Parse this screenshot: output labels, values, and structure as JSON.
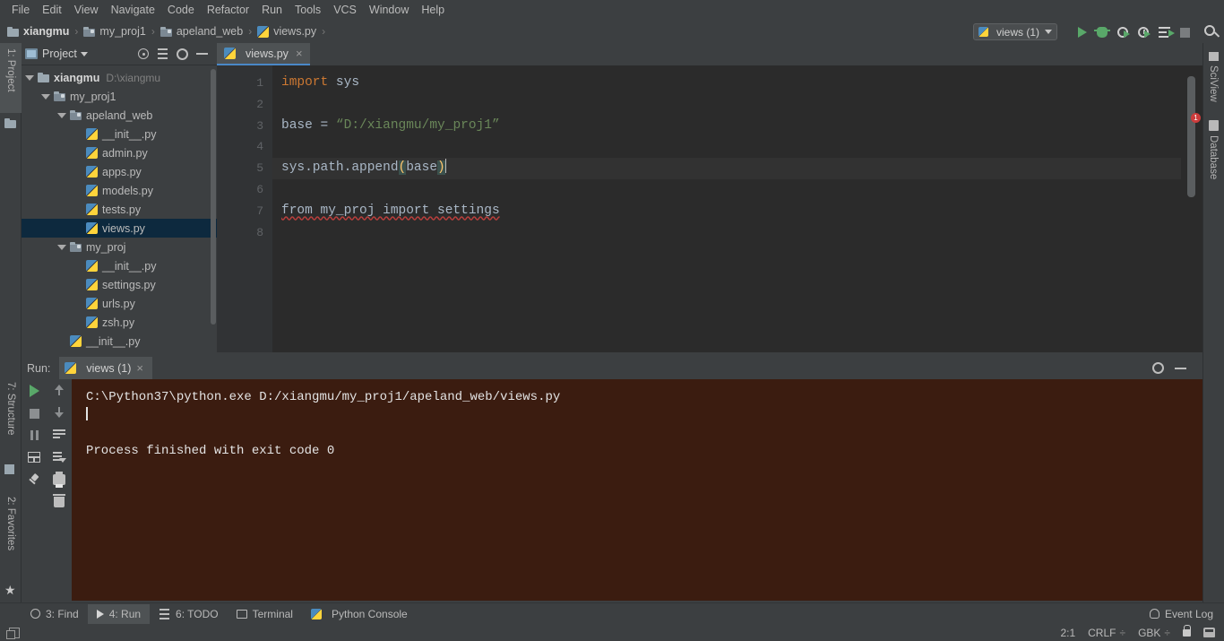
{
  "menu": {
    "items": [
      "File",
      "Edit",
      "View",
      "Navigate",
      "Code",
      "Refactor",
      "Run",
      "Tools",
      "VCS",
      "Window",
      "Help"
    ]
  },
  "breadcrumb": {
    "separator": "›",
    "items": [
      {
        "label": "xiangmu",
        "icon": "folder-icon"
      },
      {
        "label": "my_proj1",
        "icon": "module-folder-icon"
      },
      {
        "label": "apeland_web",
        "icon": "module-folder-icon"
      },
      {
        "label": "views.py",
        "icon": "python-file-icon"
      }
    ]
  },
  "toolbar": {
    "run_config": "views (1)",
    "run_icon": "run-icon",
    "debug_icon": "debug-icon",
    "coverage_icon": "run-with-coverage-icon",
    "profile_icon": "profile-icon",
    "concurrency_icon": "concurrency-diagram-icon",
    "stop_icon": "stop-icon",
    "search_icon": "search-everywhere-icon"
  },
  "left_strip": {
    "tabs": [
      {
        "label": "1: Project",
        "icon": "project-icon",
        "active": true
      },
      {
        "label": "7: Structure",
        "icon": "structure-icon",
        "active": false
      },
      {
        "label": "2: Favorites",
        "icon": "favorites-star-icon",
        "active": false
      }
    ]
  },
  "right_strip": {
    "tabs": [
      {
        "label": "SciView",
        "icon": "sciview-icon"
      },
      {
        "label": "Database",
        "icon": "database-icon"
      }
    ]
  },
  "project_panel": {
    "title": "Project",
    "header_icons": [
      "locate-icon",
      "collapse-all-icon",
      "settings-gear-icon",
      "minimize-icon"
    ],
    "tree": [
      {
        "label": "xiangmu",
        "sub": "D:\\xiangmu",
        "depth": 0,
        "icon": "folder-icon",
        "arrow": "expanded",
        "bold": true,
        "selected": false
      },
      {
        "label": "my_proj1",
        "sub": "",
        "depth": 1,
        "icon": "module-folder-icon",
        "arrow": "expanded",
        "bold": false,
        "selected": false
      },
      {
        "label": "apeland_web",
        "sub": "",
        "depth": 2,
        "icon": "module-folder-icon",
        "arrow": "expanded",
        "bold": false,
        "selected": false
      },
      {
        "label": "__init__.py",
        "sub": "",
        "depth": 3,
        "icon": "python-file-icon",
        "arrow": "none",
        "bold": false,
        "selected": false
      },
      {
        "label": "admin.py",
        "sub": "",
        "depth": 3,
        "icon": "python-file-icon",
        "arrow": "none",
        "bold": false,
        "selected": false
      },
      {
        "label": "apps.py",
        "sub": "",
        "depth": 3,
        "icon": "python-file-icon",
        "arrow": "none",
        "bold": false,
        "selected": false
      },
      {
        "label": "models.py",
        "sub": "",
        "depth": 3,
        "icon": "python-file-icon",
        "arrow": "none",
        "bold": false,
        "selected": false
      },
      {
        "label": "tests.py",
        "sub": "",
        "depth": 3,
        "icon": "python-file-icon",
        "arrow": "none",
        "bold": false,
        "selected": false
      },
      {
        "label": "views.py",
        "sub": "",
        "depth": 3,
        "icon": "python-file-icon",
        "arrow": "none",
        "bold": false,
        "selected": true
      },
      {
        "label": "my_proj",
        "sub": "",
        "depth": 2,
        "icon": "module-folder-icon",
        "arrow": "expanded",
        "bold": false,
        "selected": false
      },
      {
        "label": "__init__.py",
        "sub": "",
        "depth": 3,
        "icon": "python-file-icon",
        "arrow": "none",
        "bold": false,
        "selected": false
      },
      {
        "label": "settings.py",
        "sub": "",
        "depth": 3,
        "icon": "python-file-icon",
        "arrow": "none",
        "bold": false,
        "selected": false
      },
      {
        "label": "urls.py",
        "sub": "",
        "depth": 3,
        "icon": "python-file-icon",
        "arrow": "none",
        "bold": false,
        "selected": false
      },
      {
        "label": "zsh.py",
        "sub": "",
        "depth": 3,
        "icon": "python-file-icon",
        "arrow": "none",
        "bold": false,
        "selected": false
      },
      {
        "label": "__init__.py",
        "sub": "",
        "depth": 2,
        "icon": "python-file-icon",
        "arrow": "none",
        "bold": false,
        "selected": false
      }
    ]
  },
  "editor": {
    "tab": {
      "label": "views.py",
      "icon": "python-file-icon",
      "close": "×"
    },
    "line_numbers": [
      "1",
      "2",
      "3",
      "4",
      "5",
      "6",
      "7",
      "8"
    ],
    "lines": [
      {
        "n": "1",
        "text": "import sys",
        "highlight": false
      },
      {
        "n": "2",
        "text": "",
        "highlight": false
      },
      {
        "n": "3",
        "text": "base = “D:/xiangmu/my_proj1”",
        "highlight": false
      },
      {
        "n": "4",
        "text": "",
        "highlight": false
      },
      {
        "n": "5",
        "text": "sys.path.append(base)",
        "highlight": true
      },
      {
        "n": "6",
        "text": "",
        "highlight": false
      },
      {
        "n": "7",
        "text": "from my_proj import settings",
        "highlight": false
      },
      {
        "n": "8",
        "text": "",
        "highlight": false
      }
    ],
    "code_tokens": {
      "l1_kw": "import",
      "l1_rest": " sys",
      "l3_pre": "base = ",
      "l3_str": "“D:/xiangmu/my_proj1”",
      "l5_pre": "sys.path.append",
      "l5_open": "(",
      "l5_arg": "base",
      "l5_close": ")",
      "l7_text": "from my_proj import settings"
    },
    "error_badge": "1",
    "colors": {
      "background": "#2b2b2b",
      "gutter": "#313335",
      "keyword": "#cc7832",
      "string": "#6a8759",
      "default_text": "#a9b7c6",
      "error": "#bc3f3c",
      "caret_row": "#323232"
    }
  },
  "run_panel": {
    "label": "Run:",
    "tab": {
      "label": "views (1)",
      "icon": "python-file-icon",
      "close": "×"
    },
    "header_icons": [
      "settings-gear-icon",
      "minimize-icon"
    ],
    "side_icons": [
      "rerun-icon",
      "stop-icon",
      "pause-icon",
      "show-layout-icon",
      "pin-tab-icon",
      "up-arrow-icon",
      "down-arrow-icon",
      "soft-wrap-icon",
      "scroll-to-end-icon",
      "print-icon",
      "clear-all-icon"
    ],
    "console": {
      "command": "C:\\Python37\\python.exe D:/xiangmu/my_proj1/apeland_web/views.py",
      "blank": "",
      "result": "Process finished with exit code 0",
      "background": "#3b1c10"
    }
  },
  "bottom_tabs": {
    "items": [
      {
        "label": "3: Find",
        "icon": "find-icon",
        "active": false
      },
      {
        "label": "4: Run",
        "icon": "run-icon",
        "active": true
      },
      {
        "label": "6: TODO",
        "icon": "todo-icon",
        "active": false
      },
      {
        "label": "Terminal",
        "icon": "terminal-icon",
        "active": false
      },
      {
        "label": "Python Console",
        "icon": "python-console-icon",
        "active": false
      }
    ],
    "event_log": "Event Log",
    "event_log_icon": "bell-icon"
  },
  "statusbar": {
    "stack_icon": "stack-windows-icon",
    "caret_position": "2:1",
    "line_separator": "CRLF",
    "encoding": "GBK",
    "sep_glyph": "÷",
    "lock_icon": "read-only-lock-icon",
    "git_icon": "git-branch-icon"
  }
}
